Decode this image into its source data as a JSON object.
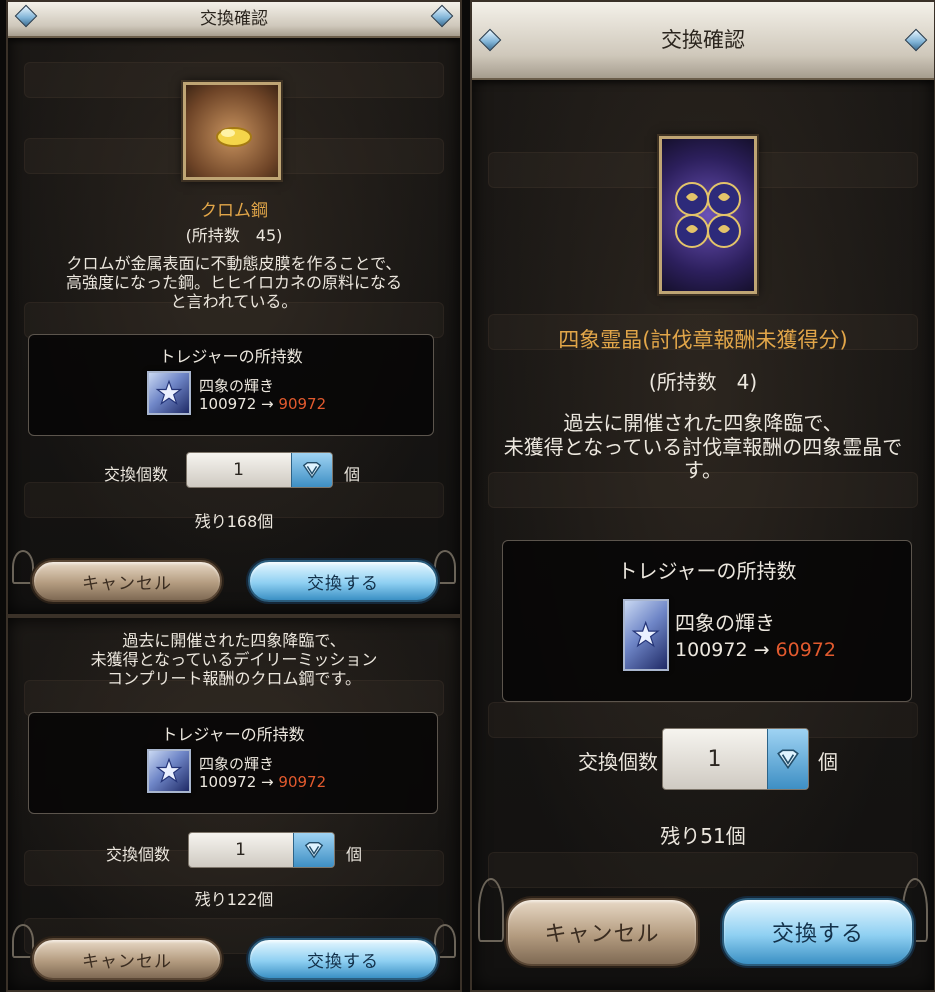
{
  "panels": [
    {
      "title": "交換確認",
      "item_name": "クロム鋼",
      "owned": "(所持数　45)",
      "description": [
        "クロムが金属表面に不動態皮膜を作ることで、",
        "高強度になった鋼。ヒヒイロカネの原料になる",
        "と言われている。"
      ],
      "treasure": {
        "title": "トレジャーの所持数",
        "name": "四象の輝き",
        "before": "100972",
        "arrow": "→",
        "after": "90972"
      },
      "qty_label": "交換個数",
      "qty_value": "1",
      "qty_unit": "個",
      "remaining": "残り168個",
      "cancel_label": "キャンセル",
      "confirm_label": "交換する"
    },
    {
      "description": [
        "過去に開催された四象降臨で、",
        "未獲得となっているデイリーミッション",
        "コンプリート報酬のクロム鋼です。"
      ],
      "treasure": {
        "title": "トレジャーの所持数",
        "name": "四象の輝き",
        "before": "100972",
        "arrow": "→",
        "after": "90972"
      },
      "qty_label": "交換個数",
      "qty_value": "1",
      "qty_unit": "個",
      "remaining": "残り122個",
      "cancel_label": "キャンセル",
      "confirm_label": "交換する"
    },
    {
      "title": "交換確認",
      "item_name": "四象霊晶(討伐章報酬未獲得分)",
      "owned": "(所持数　4)",
      "description": [
        "過去に開催された四象降臨で、",
        "未獲得となっている討伐章報酬の四象霊晶で",
        "す。"
      ],
      "treasure": {
        "title": "トレジャーの所持数",
        "name": "四象の輝き",
        "before": "100972",
        "arrow": "→",
        "after": "60972"
      },
      "qty_label": "交換個数",
      "qty_value": "1",
      "qty_unit": "個",
      "remaining": "残り51個",
      "cancel_label": "キャンセル",
      "confirm_label": "交換する"
    }
  ],
  "colors": {
    "item_name": "#e2a649",
    "after_value": "#e25a2e",
    "confirm_button": "#8fd0f2",
    "cancel_button": "#b49c80"
  },
  "icons": {
    "treasure": "star-icon",
    "chrome_steel": "gold-nugget-icon",
    "spirit_crystal": "four-orb-crystal-icon",
    "dropdown": "diamond-chevron-icon"
  }
}
